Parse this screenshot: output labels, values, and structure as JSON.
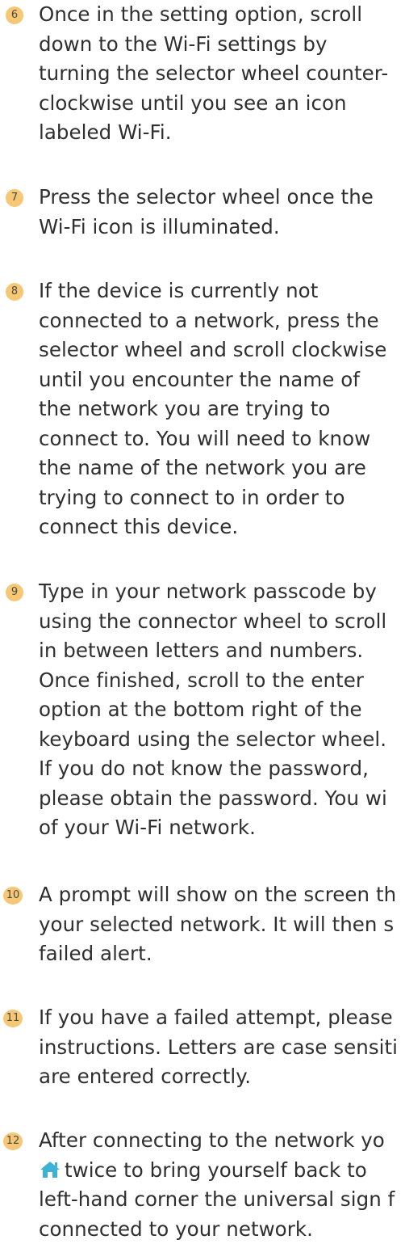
{
  "steps": [
    {
      "number": "6",
      "lines": [
        "Once in the setting option, scroll",
        "down to the Wi-Fi settings by",
        "turning the selector wheel counter-",
        "clockwise until you see an icon",
        "labeled Wi-Fi."
      ]
    },
    {
      "number": "7",
      "lines": [
        "Press the selector wheel once the",
        "Wi-Fi icon is illuminated."
      ]
    },
    {
      "number": "8",
      "lines": [
        "If the device is currently not",
        "connected to a network, press the",
        "selector wheel and scroll clockwise",
        "until you encounter the name of",
        "the network you are trying to",
        "connect to. You will need to know",
        "the name of the network you are",
        "trying to connect to in order to",
        "connect this device."
      ]
    },
    {
      "number": "9",
      "lines": [
        "Type in your network passcode by",
        "using the connector wheel to scroll",
        "in between letters and numbers.",
        "Once finished, scroll to the enter",
        "option at the bottom right of the",
        "keyboard using the selector wheel.",
        "If you do not know the password,",
        "please obtain the password. You wi",
        "of your Wi-Fi network."
      ]
    },
    {
      "number": "10",
      "lines": [
        "A prompt will show on the screen th",
        "your selected network. It will then s",
        "failed alert."
      ]
    },
    {
      "number": "11",
      "lines": [
        "If you have a failed attempt, please",
        "instructions. Letters are case sensiti",
        "are entered correctly."
      ]
    },
    {
      "number": "12",
      "lines": [
        "After connecting to the network yo",
        "twice to bring yourself back to",
        "left-hand corner the universal sign f",
        "connected to your network."
      ]
    }
  ],
  "icons": {
    "home": "home-icon"
  },
  "colors": {
    "badge": "#f6c774",
    "home_icon": "#3fb0d6",
    "text": "#2f2f2f"
  }
}
